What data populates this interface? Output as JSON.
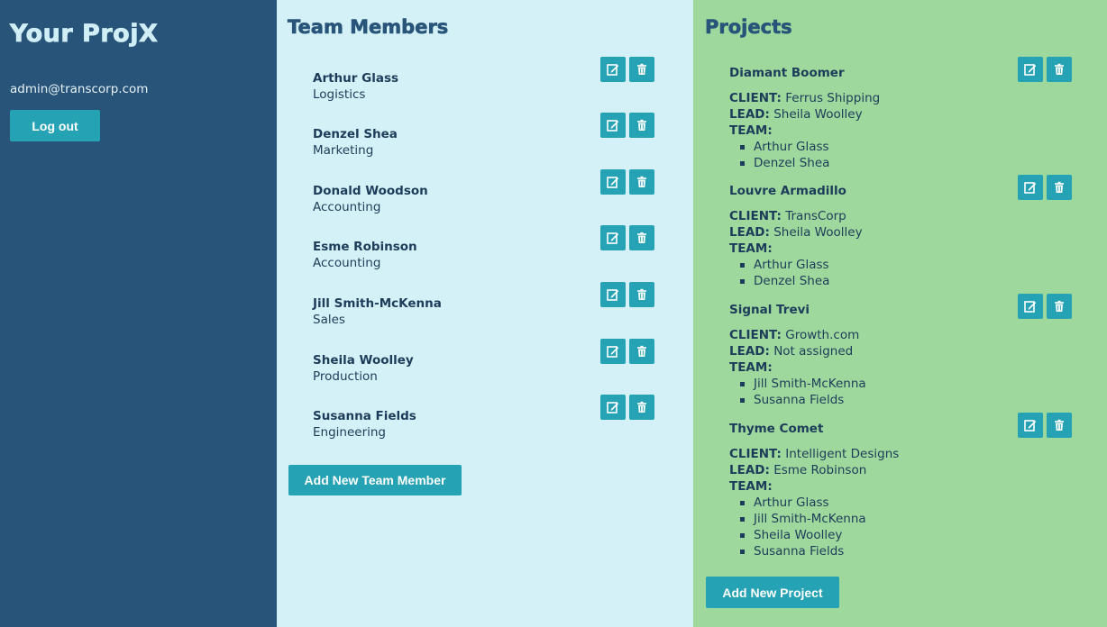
{
  "app": {
    "title": "Your ProjX"
  },
  "sidebar": {
    "email": "admin@transcorp.com",
    "logout_label": "Log out"
  },
  "team": {
    "title": "Team Members",
    "add_label": "Add New Team Member",
    "members": [
      {
        "name": "Arthur Glass",
        "department": "Logistics"
      },
      {
        "name": "Denzel Shea",
        "department": "Marketing"
      },
      {
        "name": "Donald Woodson",
        "department": "Accounting"
      },
      {
        "name": "Esme Robinson",
        "department": "Accounting"
      },
      {
        "name": "Jill Smith-McKenna",
        "department": "Sales"
      },
      {
        "name": "Sheila Woolley",
        "department": "Production"
      },
      {
        "name": "Susanna Fields",
        "department": "Engineering"
      }
    ]
  },
  "projects": {
    "title": "Projects",
    "add_label": "Add New Project",
    "labels": {
      "client": "CLIENT:",
      "lead": "LEAD:",
      "team": "TEAM:"
    },
    "items": [
      {
        "name": "Diamant Boomer",
        "client": "Ferrus Shipping",
        "lead": "Sheila Woolley",
        "team": [
          "Arthur Glass",
          "Denzel Shea"
        ]
      },
      {
        "name": "Louvre Armadillo",
        "client": "TransCorp",
        "lead": "Sheila Woolley",
        "team": [
          "Arthur Glass",
          "Denzel Shea"
        ]
      },
      {
        "name": "Signal Trevi",
        "client": "Growth.com",
        "lead": "Not assigned",
        "team": [
          "Jill Smith-McKenna",
          "Susanna Fields"
        ]
      },
      {
        "name": "Thyme Comet",
        "client": "Intelligent Designs",
        "lead": "Esme Robinson",
        "team": [
          "Arthur Glass",
          "Jill Smith-McKenna",
          "Sheila Woolley",
          "Susanna Fields"
        ]
      }
    ]
  },
  "icons": {
    "edit": "edit-icon",
    "delete": "trash-icon"
  },
  "colors": {
    "sidebar": "#28547a",
    "team_bg": "#d3f1f6",
    "projects_bg": "#9ed89c",
    "accent": "#25a2b3",
    "heading": "#28547a"
  }
}
